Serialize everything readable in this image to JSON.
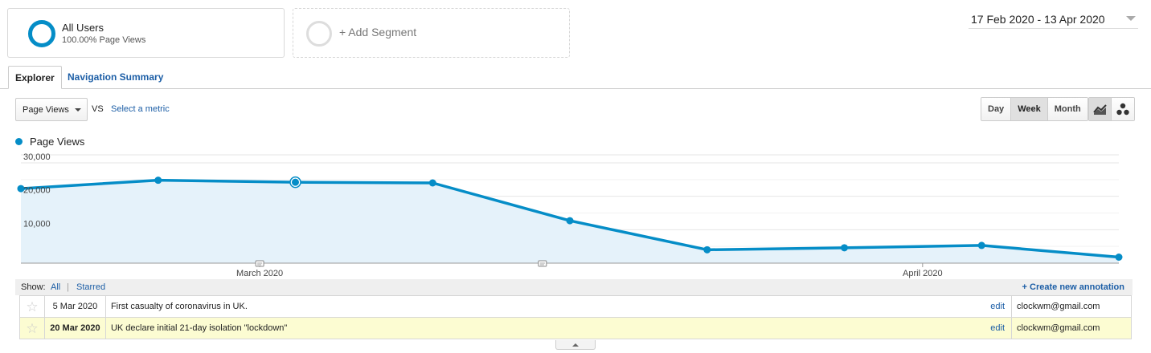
{
  "segments": {
    "active": {
      "name": "All Users",
      "subtitle": "100.00% Page Views"
    },
    "add_label": "+ Add Segment"
  },
  "date_range": "17 Feb 2020 - 13 Apr 2020",
  "tabs": [
    {
      "label": "Explorer",
      "active": true
    },
    {
      "label": "Navigation Summary",
      "active": false
    }
  ],
  "metric_bar": {
    "metric": "Page Views",
    "vs_label": "VS",
    "select_metric_label": "Select a metric",
    "periods": [
      {
        "label": "Day"
      },
      {
        "label": "Week",
        "active": true
      },
      {
        "label": "Month"
      }
    ],
    "views": [
      "line-chart-icon",
      "motion-chart-icon"
    ]
  },
  "colors": {
    "series": "#058dc7",
    "area": "#e5f2fa",
    "link": "#1c5ea6",
    "highlight": "#fcfcd2"
  },
  "chart_data": {
    "type": "area",
    "series": [
      {
        "name": "Page Views",
        "values": [
          22300,
          24800,
          24200,
          24000,
          12700,
          4000,
          4600,
          5300,
          1800
        ]
      }
    ],
    "selected_index": 2,
    "ylim": [
      0,
      30000
    ],
    "y_ticks": [
      {
        "value": 10000,
        "label": "10,000"
      },
      {
        "value": 20000,
        "label": "20,000"
      },
      {
        "value": 30000,
        "label": "30,000"
      }
    ],
    "x_labels": [
      {
        "at": 1.74,
        "label": "March 2020"
      },
      {
        "at": 6.57,
        "label": "April 2020"
      }
    ],
    "annotation_markers": [
      1.74,
      3.8
    ],
    "grid": true
  },
  "annotations": {
    "show_label": "Show:",
    "filters": [
      "All",
      "Starred"
    ],
    "separator": "|",
    "create_label": "+ Create new annotation",
    "edit_label": "edit",
    "rows": [
      {
        "date": "5 Mar 2020",
        "text": "First casualty of coronavirus in UK.",
        "user": "clockwm@gmail.com",
        "highlighted": false
      },
      {
        "date": "20 Mar 2020",
        "text": "UK declare initial 21-day isolation \"lockdown\"",
        "user": "clockwm@gmail.com",
        "highlighted": true
      }
    ]
  }
}
